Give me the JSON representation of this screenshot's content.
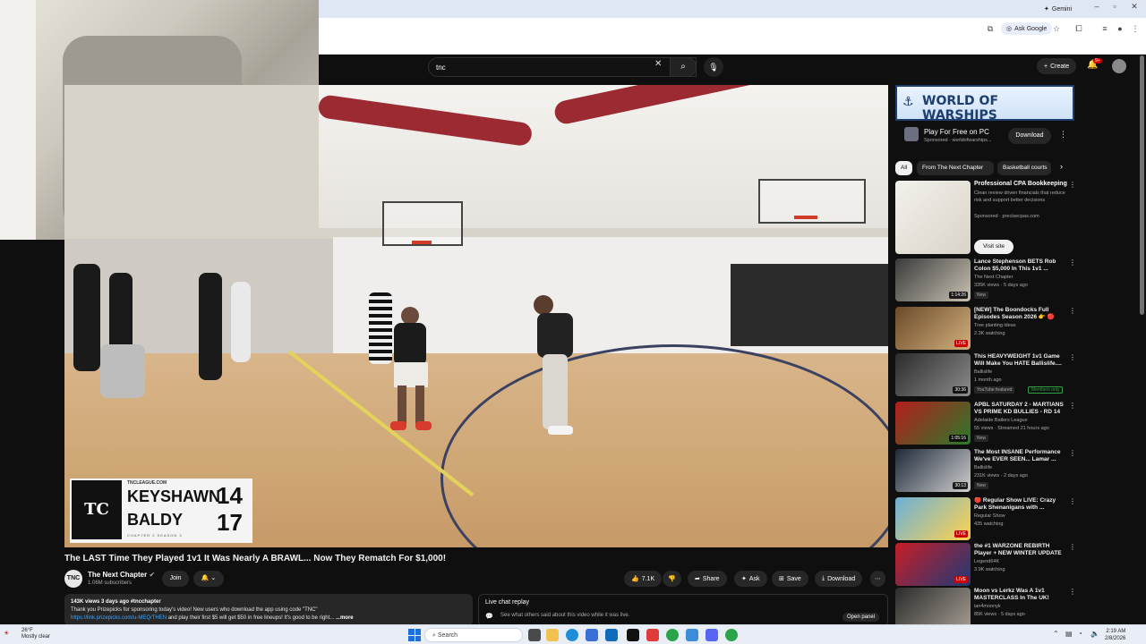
{
  "browser": {
    "gemini_label": "Gemini",
    "ask_google_label": "Ask Google"
  },
  "youtube": {
    "search_value": "tnc",
    "create_label": "Create",
    "notif_count": "9+"
  },
  "video": {
    "scoreboard": {
      "tag": "TNCLEAGUE.COM",
      "player1": "KEYSHAWN",
      "score1": "14",
      "player2": "BALDY",
      "score2": "17",
      "footer": "CHAPTER 2  SEASON 3"
    },
    "title": "The LAST Time They Played 1v1 It Was Nearly A BRAWL... Now They Rematch For $1,000!",
    "channel": "The Next Chapter",
    "channel_avatar": "TNC",
    "subscribers": "1.06M subscribers",
    "join_label": "Join",
    "likes": "7.1K",
    "share_label": "Share",
    "ask_label": "Ask",
    "save_label": "Save",
    "download_label": "Download",
    "description": {
      "stats": "143K views  3 days ago  #tncchapter",
      "line1": "Thank you Prizepicks for sponsoring today's video! New users who download the app using code \"TNC\"",
      "line2_link": "https://link.prizepicks.com/u-MEQ/THEN",
      "line2_rest": " and play their first $5 will get $50 in free lineups! It's good to be right...",
      "more": "...more"
    },
    "chat": {
      "title": "Live chat replay",
      "subtitle": "See what others said about this video while it was live.",
      "open_panel": "Open panel"
    }
  },
  "sidebar": {
    "ad": {
      "banner": "WORLD OF WARSHIPS",
      "title": "Play For Free on PC",
      "sponsor": "Sponsored · worldofwarships...",
      "download_label": "Download"
    },
    "chips": [
      "All",
      "From The Next Chapter",
      "Basketball courts"
    ],
    "ad2": {
      "title": "Professional CPA Bookkeeping",
      "desc": "Clean review driven financials that reduce risk and support better decisions",
      "sponsor": "Sponsored · precisecpas.com",
      "visit_label": "Visit site"
    },
    "recs": [
      {
        "title": "Lance Stephenson BETS Rob Colon $5,000 In This 1v1 ...",
        "channel": "The Next Chapter",
        "meta": "335K views · 5 days ago",
        "badge": "New",
        "duration": "1:14:26"
      },
      {
        "title": "[NEW] The Boondocks Full Episodes Season 2026 👉 🔴",
        "channel": "Tree planting ideas",
        "meta": "2.3K watching",
        "badge": "",
        "duration": "LIVE"
      },
      {
        "title": "This HEAVYWEIGHT 1v1 Game Will Make You HATE Ballislife....",
        "channel": "Ballislife",
        "meta": "1 month ago",
        "badge": "YouTube featured",
        "members": "Members only",
        "duration": "30:36"
      },
      {
        "title": "APBL SATURDAY 2 - MARTIANS VS PRIME KD BULLIES - RD 14",
        "channel": "Adelaide Ballers League",
        "meta": "55 views · Streamed 21 hours ago",
        "badge": "New",
        "duration": "1:05:16"
      },
      {
        "title": "The Most INSANE Performance We've EVER SEEN... Lamar ...",
        "channel": "Ballislife",
        "meta": "231K views · 2 days ago",
        "badge": "New",
        "duration": "30:13"
      },
      {
        "title": "🔴 Regular Show LIVE: Crazy Park Shenanigans with ...",
        "channel": "Regular Show",
        "meta": "435 watching",
        "badge": "",
        "duration": "LIVE"
      },
      {
        "title": "the #1 WARZONE REBIRTH Player + NEW WINTER UPDATE",
        "channel": "Legend64K",
        "meta": "3.9K watching",
        "badge": "",
        "duration": "LIVE"
      },
      {
        "title": "Moon vs Lerkz Was A 1v1 MASTERCLASS In The UK!",
        "channel": "ian4moonyk",
        "meta": "85K views · 5 days ago",
        "badge": "",
        "duration": ""
      }
    ]
  },
  "taskbar": {
    "temp": "26°F",
    "weather": "Mostly clear",
    "search_label": "Search",
    "time": "2:19 AM",
    "date": "2/8/2026"
  }
}
